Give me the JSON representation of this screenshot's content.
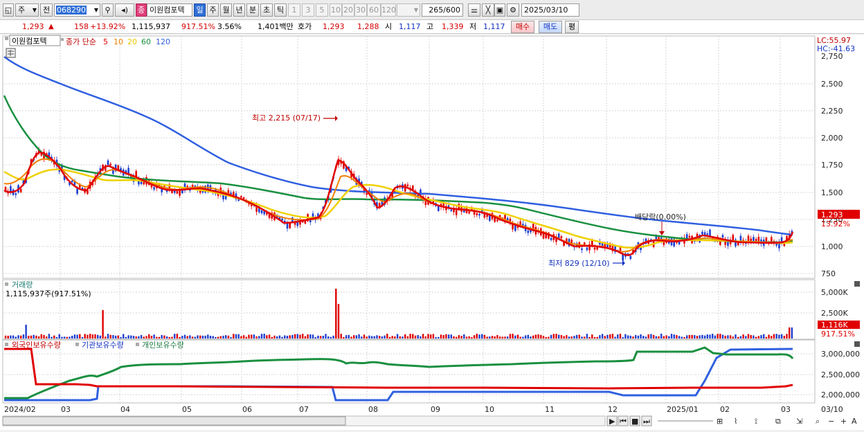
{
  "toolbar": {
    "period_type": "주",
    "prev_label": "전",
    "stock_code": "068290",
    "stock_name_badge": "종",
    "stock_name": "이원컴포텍",
    "intervals": [
      "일",
      "주",
      "월",
      "년",
      "분",
      "초",
      "틱"
    ],
    "interval_selected": "일",
    "numbers": [
      "1",
      "3",
      "5",
      "10",
      "20",
      "30",
      "60",
      "120"
    ],
    "count_display": "265",
    "count_total": "/600",
    "date": "2025/03/10"
  },
  "info": {
    "price": "1,293",
    "change_arrow": "▲",
    "change": "158",
    "change_pct": "+13.92%",
    "volume": "1,115,937",
    "volume_ratio": "917.51%",
    "turnover_pct": "3.56%",
    "amount": "1,401백만",
    "quote_label": "호가",
    "ask": "1,293",
    "bid": "1,288",
    "open_label": "시",
    "open": "1,117",
    "high_label": "고",
    "high": "1,339",
    "low_label": "저",
    "low": "1,117",
    "buy_label": "매수",
    "sell_label": "매도",
    "eval_label": "평"
  },
  "price_panel": {
    "name": "이원컴포텍",
    "legend_prefix": "종가 단순",
    "ma_labels": [
      "5",
      "10",
      "20",
      "60",
      "120"
    ],
    "ma_colors": [
      "#e00000",
      "#f08000",
      "#f0d000",
      "#1a9040",
      "#3060e0"
    ],
    "lc": "LC:55.97",
    "hc": "HC:-41.63",
    "y_ticks": [
      "2,750",
      "2,500",
      "2,250",
      "2,000",
      "1,750",
      "1,500",
      "1,250",
      "1,000",
      "750"
    ],
    "high_note": "최고 2,215 (07/17)",
    "low_note": "최저 829 (12/10)",
    "dividend_note": "배당락(0.00%)",
    "price_tag": "1,293",
    "pct_tag": "13.92%"
  },
  "volume_panel": {
    "title": "거래량",
    "value": "1,115,937주(917.51%)",
    "y_ticks": [
      "5,000K",
      "2,500K",
      "0"
    ],
    "tag": "1,116K",
    "tag_pct": "917.51%"
  },
  "holdings_panel": {
    "legend": [
      "외국인보유수량",
      "기관보유수량",
      "개인보유수량"
    ],
    "legend_colors": [
      "#e00000",
      "#3060e0",
      "#1a9040"
    ],
    "y_ticks": [
      "3,000,000",
      "2,500,000",
      "2,000,000"
    ]
  },
  "x_axis": {
    "labels": [
      "2024/02",
      "03",
      "04",
      "05",
      "06",
      "07",
      "08",
      "09",
      "10",
      "11",
      "12",
      "2025/01",
      "02",
      "03"
    ],
    "corner": "03/10"
  },
  "chart_data": {
    "type": "candlestick",
    "title": "이원컴포텍",
    "ylim": [
      750,
      2750
    ],
    "high": {
      "value": 2215,
      "date": "07/17"
    },
    "low": {
      "value": 829,
      "date": "12/10"
    },
    "last_close": 1293,
    "ma_price_points": {
      "x_months": [
        "2024/02",
        "03",
        "04",
        "05",
        "06",
        "07",
        "08",
        "09",
        "10",
        "11",
        "12",
        "2025/01",
        "02",
        "03"
      ],
      "ma120": [
        2700,
        2450,
        2200,
        1950,
        1700,
        1580,
        1520,
        1480,
        1420,
        1350,
        1290,
        1230,
        1150,
        1100
      ],
      "ma60": [
        2300,
        1850,
        1650,
        1580,
        1550,
        1460,
        1440,
        1420,
        1380,
        1260,
        1120,
        1040,
        1030,
        1040
      ],
      "ma20": [
        1600,
        1580,
        1620,
        1530,
        1460,
        1300,
        1430,
        1440,
        1330,
        1180,
        980,
        1040,
        1020,
        1040
      ]
    },
    "volume_spikes_k": [
      {
        "date": "2024/07/17",
        "value": 5600
      },
      {
        "date": "2024/03/20",
        "value": 3200
      },
      {
        "date": "2025/03/10",
        "value": 1116
      }
    ]
  }
}
